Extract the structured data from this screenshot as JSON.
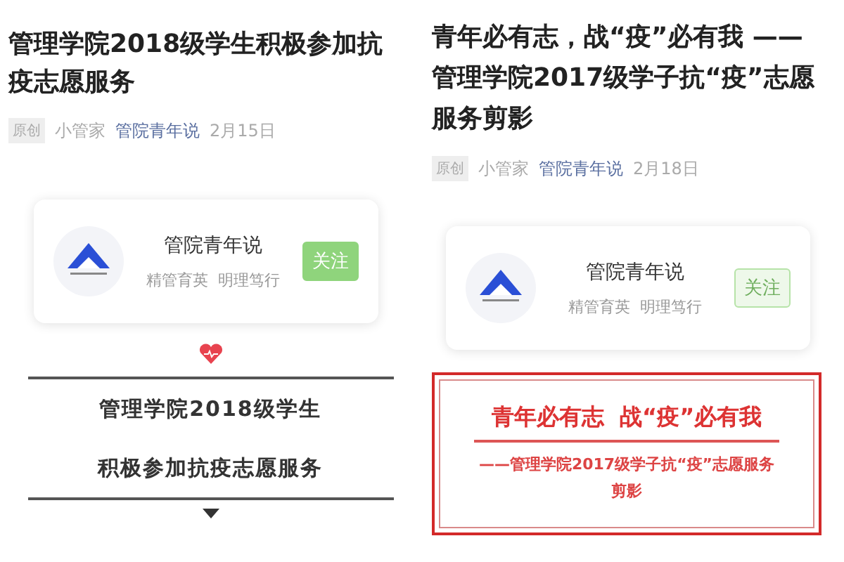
{
  "posts": [
    {
      "title": "管理学院2018级学生积极参加抗疫志愿服务",
      "meta": {
        "tag": "原创",
        "author": "小管家",
        "account": "管院青年说",
        "date": "2月15日"
      },
      "card": {
        "name": "管院青年说",
        "slogan": "精管育英  明理笃行",
        "follow": {
          "label": "关注",
          "kind": "filled"
        }
      },
      "banner": {
        "kind": "heart",
        "lines": [
          "管理学院2018级学生",
          "积极参加抗疫志愿服务"
        ]
      }
    },
    {
      "title": "青年必有志，战“疫”必有我 ——管理学院2017级学子抗“疫”志愿服务剪影",
      "meta": {
        "tag": "原创",
        "author": "小管家",
        "account": "管院青年说",
        "date": "2月18日"
      },
      "card": {
        "name": "管院青年说",
        "slogan": "精管育英  明理笃行",
        "follow": {
          "label": "关注",
          "kind": "faded"
        }
      },
      "banner": {
        "kind": "frame",
        "lines": [
          "青年必有志  战“疫”必有我",
          "——管理学院2017级学子抗“疫”志愿服务",
          "剪影"
        ]
      }
    }
  ]
}
